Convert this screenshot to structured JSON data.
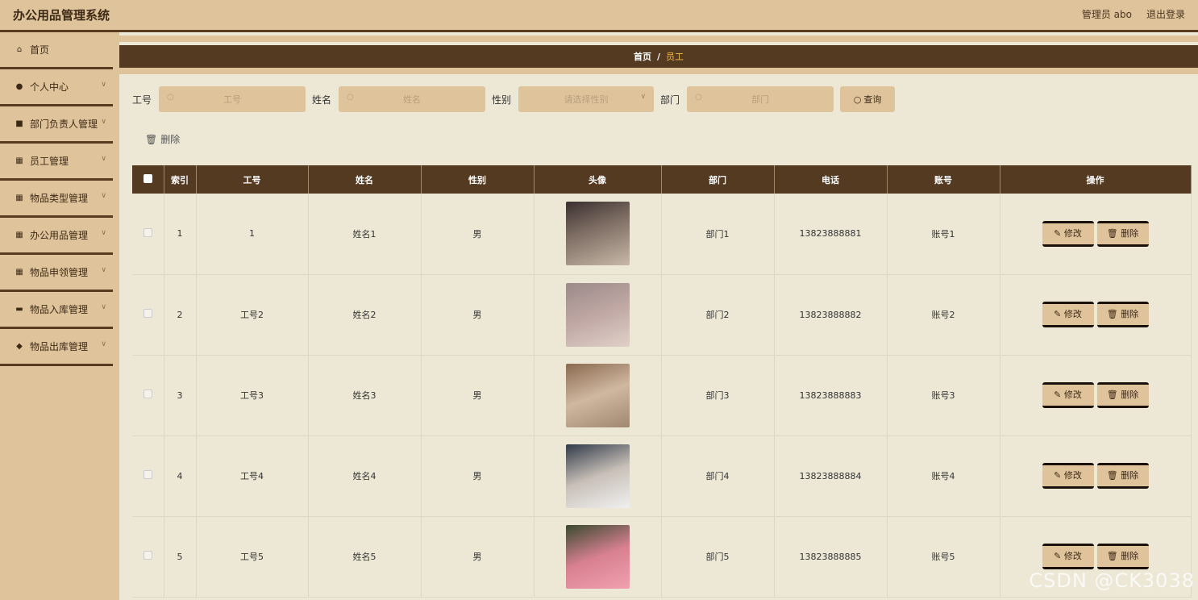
{
  "header": {
    "title": "办公用品管理系统",
    "user_label": "管理员 abo",
    "logout_label": "退出登录"
  },
  "sidebar": {
    "items": [
      {
        "label": "首页",
        "icon": "home-icon",
        "glyph": "⌂",
        "has_chevron": false
      },
      {
        "label": "个人中心",
        "icon": "user-icon",
        "glyph": "●",
        "has_chevron": true
      },
      {
        "label": "部门负责人管理",
        "icon": "folder-icon",
        "glyph": "■",
        "has_chevron": true
      },
      {
        "label": "员工管理",
        "icon": "grid-icon",
        "glyph": "▦",
        "has_chevron": true
      },
      {
        "label": "物品类型管理",
        "icon": "grid-icon",
        "glyph": "▦",
        "has_chevron": true
      },
      {
        "label": "办公用品管理",
        "icon": "grid-icon",
        "glyph": "▦",
        "has_chevron": true
      },
      {
        "label": "物品申领管理",
        "icon": "grid-icon",
        "glyph": "▦",
        "has_chevron": true
      },
      {
        "label": "物品入库管理",
        "icon": "message-icon",
        "glyph": "▬",
        "has_chevron": true
      },
      {
        "label": "物品出库管理",
        "icon": "pin-icon",
        "glyph": "◆",
        "has_chevron": true
      }
    ]
  },
  "breadcrumb": {
    "home": "首页",
    "separator": "/",
    "current": "员工"
  },
  "search": {
    "emp_no_label": "工号",
    "emp_no_placeholder": "工号",
    "name_label": "姓名",
    "name_placeholder": "姓名",
    "gender_label": "性别",
    "gender_placeholder": "请选择性别",
    "dept_label": "部门",
    "dept_placeholder": "部门",
    "query_label": "查询"
  },
  "toolbar": {
    "delete_label": "删除"
  },
  "table": {
    "headers": [
      "",
      "索引",
      "工号",
      "姓名",
      "性别",
      "头像",
      "部门",
      "电话",
      "账号",
      "操作"
    ],
    "rows": [
      {
        "index": "1",
        "emp_no": "1",
        "name": "姓名1",
        "gender": "男",
        "dept": "部门1",
        "phone": "13823888881",
        "account": "账号1"
      },
      {
        "index": "2",
        "emp_no": "工号2",
        "name": "姓名2",
        "gender": "男",
        "dept": "部门2",
        "phone": "13823888882",
        "account": "账号2"
      },
      {
        "index": "3",
        "emp_no": "工号3",
        "name": "姓名3",
        "gender": "男",
        "dept": "部门3",
        "phone": "13823888883",
        "account": "账号3"
      },
      {
        "index": "4",
        "emp_no": "工号4",
        "name": "姓名4",
        "gender": "男",
        "dept": "部门4",
        "phone": "13823888884",
        "account": "账号4"
      },
      {
        "index": "5",
        "emp_no": "工号5",
        "name": "姓名5",
        "gender": "男",
        "dept": "部门5",
        "phone": "13823888885",
        "account": "账号5"
      }
    ],
    "edit_label": "修改",
    "delete_label": "删除"
  },
  "watermark": "CSDN @CK3038"
}
